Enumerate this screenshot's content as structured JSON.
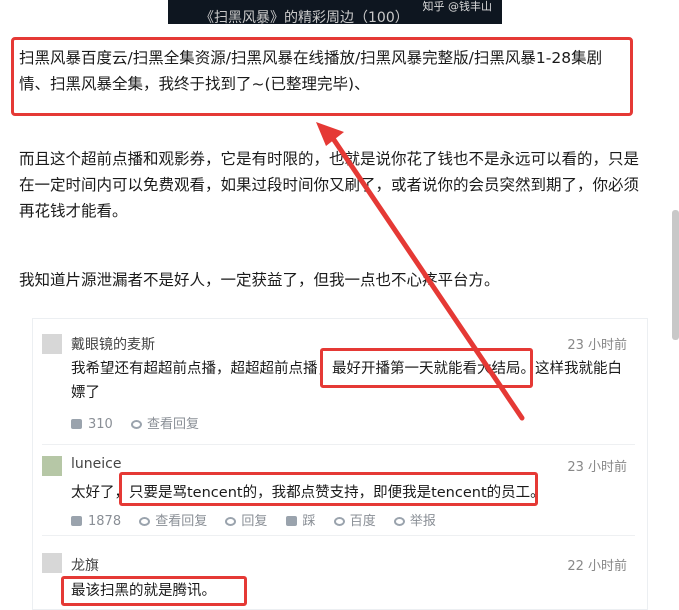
{
  "top_image": {
    "caption": "《扫黑风暴》的精彩周边（100）",
    "watermark": "知乎 @钱丰山"
  },
  "highlight_text": "扫黑风暴百度云/扫黑全集资源/扫黑风暴在线播放/扫黑风暴完整版/扫黑风暴1-28集剧情、扫黑风暴全集，我终于找到了~(已整理完毕)、",
  "para1": "而且这个超前点播和观影券，它是有时限的，也就是说你花了钱也不是永远可以看的，只是在一定时间内可以免费观看，如果过段时间你又刷了，或者说你的会员突然到期了，你必须再花钱才能看。",
  "para2": "我知道片源泄漏者不是好人，一定获益了，但我一点也不心疼平台方。",
  "comments": [
    {
      "user": "戴眼镜的麦斯",
      "time": "23 小时前",
      "text": "我希望还有超超前点播，超超超前点播，最好开播第一天就能看大结局。这样我就能白嫖了",
      "likes": "310",
      "view_replies": "查看回复"
    },
    {
      "user": "luneice",
      "time": "23 小时前",
      "text": "太好了，只要是骂tencent的，我都点赞支持，即便我是tencent的员工。",
      "likes": "1878",
      "view_replies": "查看回复",
      "reply": "回复",
      "dislike": "踩",
      "share": "百度",
      "report": "举报"
    },
    {
      "user": "龙旗",
      "time": "22 小时前",
      "text": "最该扫黑的就是腾讯。"
    }
  ],
  "accent_color": "#e53935"
}
